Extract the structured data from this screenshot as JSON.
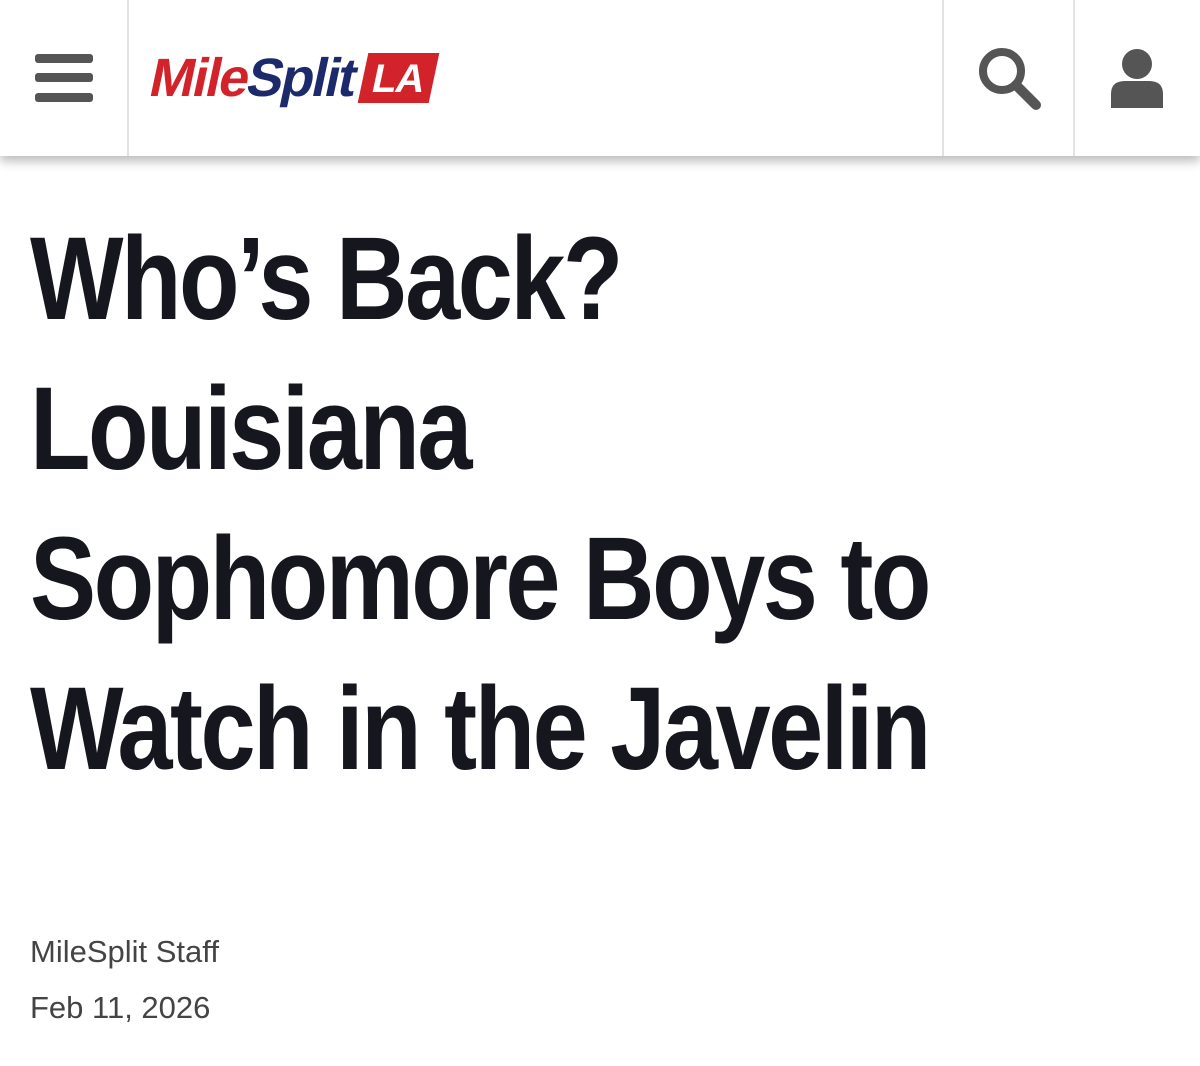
{
  "header": {
    "logo": {
      "part1": "Mile",
      "part2": "Split",
      "badge": "LA",
      "colors": {
        "red": "#d2232a",
        "navy": "#1c2a6b"
      }
    },
    "icons": {
      "menu": "hamburger-menu-icon",
      "search": "search-icon",
      "account": "user-icon"
    }
  },
  "article": {
    "headline_lines": [
      "Who’s Back?",
      "Louisiana",
      "Sophomore Boys to",
      "Watch in the Javelin"
    ],
    "author": "MileSplit Staff",
    "date": "Feb 11, 2026"
  }
}
